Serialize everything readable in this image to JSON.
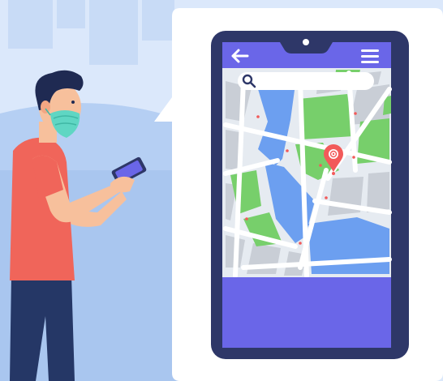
{
  "scene": {
    "description_free": true,
    "colors": {
      "sky": "#dbe8fb",
      "skyline": "#c4d8f6",
      "ground": "#a9c8f1",
      "panel": "#ffffff",
      "phone_frame": "#2e3768",
      "phone_accent": "#6a66e8",
      "map_road": "#e6ebf1",
      "map_block_gray": "#c9ced6",
      "map_park": "#77cf6b",
      "map_water": "#6c9ff0",
      "pin": "#f25a5a",
      "shirt": "#f0655a",
      "pants": "#253766",
      "mask": "#5fd6c3",
      "skin": "#f7c09c",
      "hair": "#1f2a52"
    }
  },
  "phone": {
    "header": {
      "back_icon": "arrow-left-icon",
      "menu_icon": "hamburger-menu-icon"
    },
    "search": {
      "icon": "search-icon",
      "value": ""
    },
    "map": {
      "pin_icon": "location-pin-icon"
    },
    "bottom_panel": {
      "text": ""
    }
  }
}
